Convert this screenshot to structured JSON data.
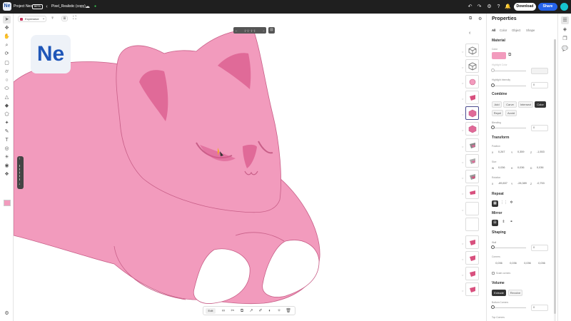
{
  "app": {
    "name": "Project Neo",
    "badge": "BETA",
    "file_name": "Pixel_Realistic (copy)",
    "logo": "Ne",
    "logo_small": "Ne"
  },
  "header": {
    "download_label": "Download",
    "share_label": "Share"
  },
  "canvas": {
    "material_dropdown": "Expressive",
    "pager_text": "| · | · | · |",
    "accent_color": "#f29bbd"
  },
  "bottom_toolbar": {
    "edit_label": "Edit"
  },
  "properties": {
    "title": "Properties",
    "tabs": [
      "All",
      "Color",
      "Object",
      "Shape"
    ],
    "material": {
      "title": "Material",
      "color_label": "Color",
      "color_value": "#f29bbd",
      "highlight_color_label": "Highlight Color",
      "highlight_intensity_label": "Highlight Intensity",
      "highlight_intensity_value": "0"
    },
    "combine": {
      "title": "Combine",
      "buttons": [
        "Add",
        "Carve",
        "Intersect",
        "Color",
        "Repel",
        "Avoid"
      ],
      "blending_label": "Blending",
      "blending_value": "0"
    },
    "transform": {
      "title": "Transform",
      "position_label": "Position",
      "position": {
        "x": "0,267",
        "y": "0,359",
        "z": "-1,553"
      },
      "size_label": "Size",
      "size": {
        "w": "0,036",
        "h": "0,036",
        "d": "0,036"
      },
      "rotation_label": "Rotation",
      "rotation": {
        "x": "-89,837",
        "y": "-28,389",
        "z": "-0,753"
      }
    },
    "repeat": {
      "title": "Repeat"
    },
    "mirror": {
      "title": "Mirror"
    },
    "shaping": {
      "title": "Shaping",
      "wall_label": "Wall",
      "wall_value": "0",
      "corners_label": "Corners",
      "corners": [
        "0,036",
        "0,036",
        "0,036",
        "0,036"
      ],
      "scale_corners_label": "Scale corners"
    },
    "volume": {
      "title": "Volume",
      "buttons": [
        "Extrude",
        "Revolve"
      ],
      "bottom_corners_label": "Bottom Corners",
      "bottom_corners_value": "0",
      "top_corners_label": "Top Corners"
    }
  }
}
